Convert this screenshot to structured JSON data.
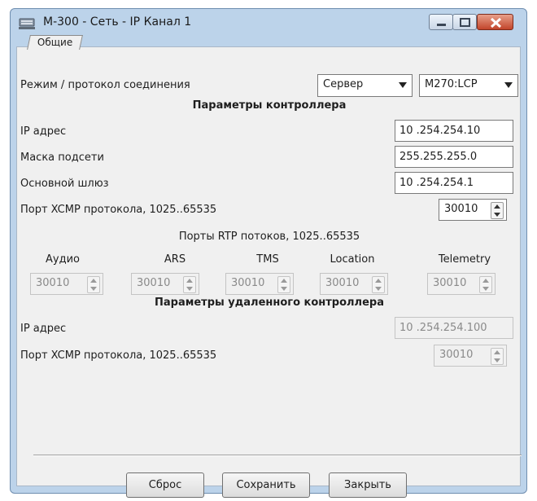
{
  "window": {
    "title": "М-300 - Сеть - IP Канал 1",
    "tab_label": "Общие"
  },
  "connection": {
    "label": "Режим / протокол соединения",
    "mode_value": "Сервер",
    "protocol_value": "M270:LCP"
  },
  "controller": {
    "heading": "Параметры контроллера",
    "ip_label": "IP адрес",
    "ip_value": "10 .254.254.10",
    "mask_label": "Маска подсети",
    "mask_value": "255.255.255.0",
    "gateway_label": "Основной шлюз",
    "gateway_value": "10 .254.254.1",
    "xcmp_label": "Порт XCMP протокола, 1025..65535",
    "xcmp_value": "30010"
  },
  "rtp": {
    "heading": "Порты RTP потоков, 1025..65535",
    "columns": [
      {
        "label": "Аудио",
        "value": "30010"
      },
      {
        "label": "ARS",
        "value": "30010"
      },
      {
        "label": "TMS",
        "value": "30010"
      },
      {
        "label": "Location",
        "value": "30010"
      },
      {
        "label": "Telemetry",
        "value": "30010"
      }
    ]
  },
  "remote": {
    "heading": "Параметры удаленного контроллера",
    "ip_label": "IP адрес",
    "ip_value": "10 .254.254.100",
    "xcmp_label": "Порт XCMP протокола, 1025..65535",
    "xcmp_value": "30010"
  },
  "buttons": {
    "reset": "Сброс",
    "save": "Сохранить",
    "close": "Закрыть"
  },
  "colors": {
    "titlebar": "#bcd3ea",
    "client": "#f0f0f0",
    "close_button": "#c2452b"
  }
}
